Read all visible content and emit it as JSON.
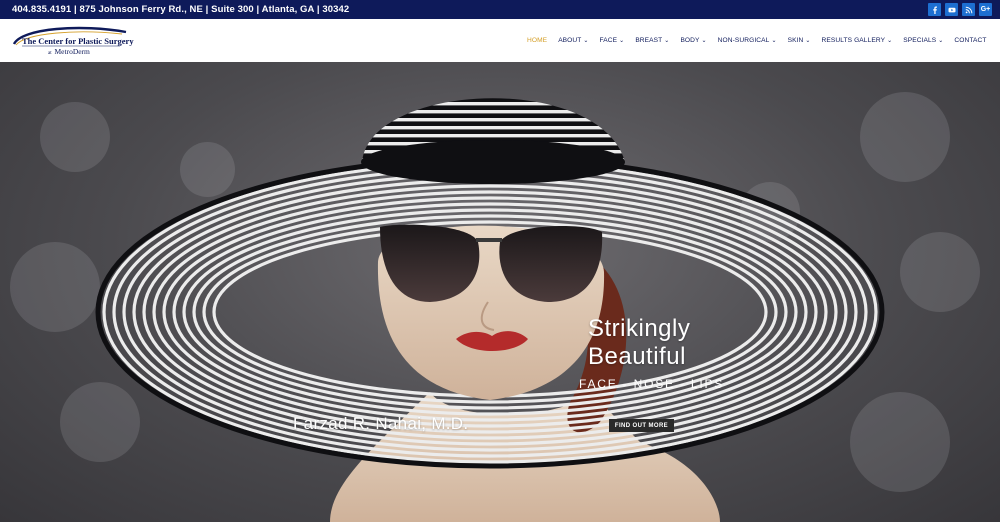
{
  "topbar": {
    "contact_text": "404.835.4191 | 875 Johnson Ferry Rd., NE | Suite 300 | Atlanta, GA | 30342",
    "social": [
      {
        "icon": "facebook-icon",
        "glyph": "f"
      },
      {
        "icon": "youtube-icon",
        "glyph": "▶"
      },
      {
        "icon": "rss-icon",
        "glyph": "rss"
      },
      {
        "icon": "google-plus-icon",
        "glyph": "G+"
      }
    ],
    "bg_color": "#0e1a5a",
    "social_color": "#1d6fd1"
  },
  "logo": {
    "line1": "The Center for Plastic Surgery",
    "at": "at",
    "line2": "MetroDerm"
  },
  "nav": {
    "items": [
      {
        "label": "HOME",
        "active": true,
        "dropdown": false
      },
      {
        "label": "ABOUT",
        "active": false,
        "dropdown": true
      },
      {
        "label": "FACE",
        "active": false,
        "dropdown": true
      },
      {
        "label": "BREAST",
        "active": false,
        "dropdown": true
      },
      {
        "label": "BODY",
        "active": false,
        "dropdown": true
      },
      {
        "label": "NON-SURGICAL",
        "active": false,
        "dropdown": true
      },
      {
        "label": "SKIN",
        "active": false,
        "dropdown": true
      },
      {
        "label": "RESULTS GALLERY",
        "active": false,
        "dropdown": true
      },
      {
        "label": "SPECIALS",
        "active": false,
        "dropdown": true
      },
      {
        "label": "CONTACT",
        "active": false,
        "dropdown": false
      }
    ],
    "active_color": "#d5a02a",
    "text_color": "#0e1a5a"
  },
  "hero": {
    "headline_line1": "Strikingly",
    "headline_line2": "Beautiful",
    "subheadline": "FACE - NOSE - LIPS",
    "doctor": "Farzad R. Nahai, M.D.",
    "cta_label": "FIND OUT MORE"
  }
}
